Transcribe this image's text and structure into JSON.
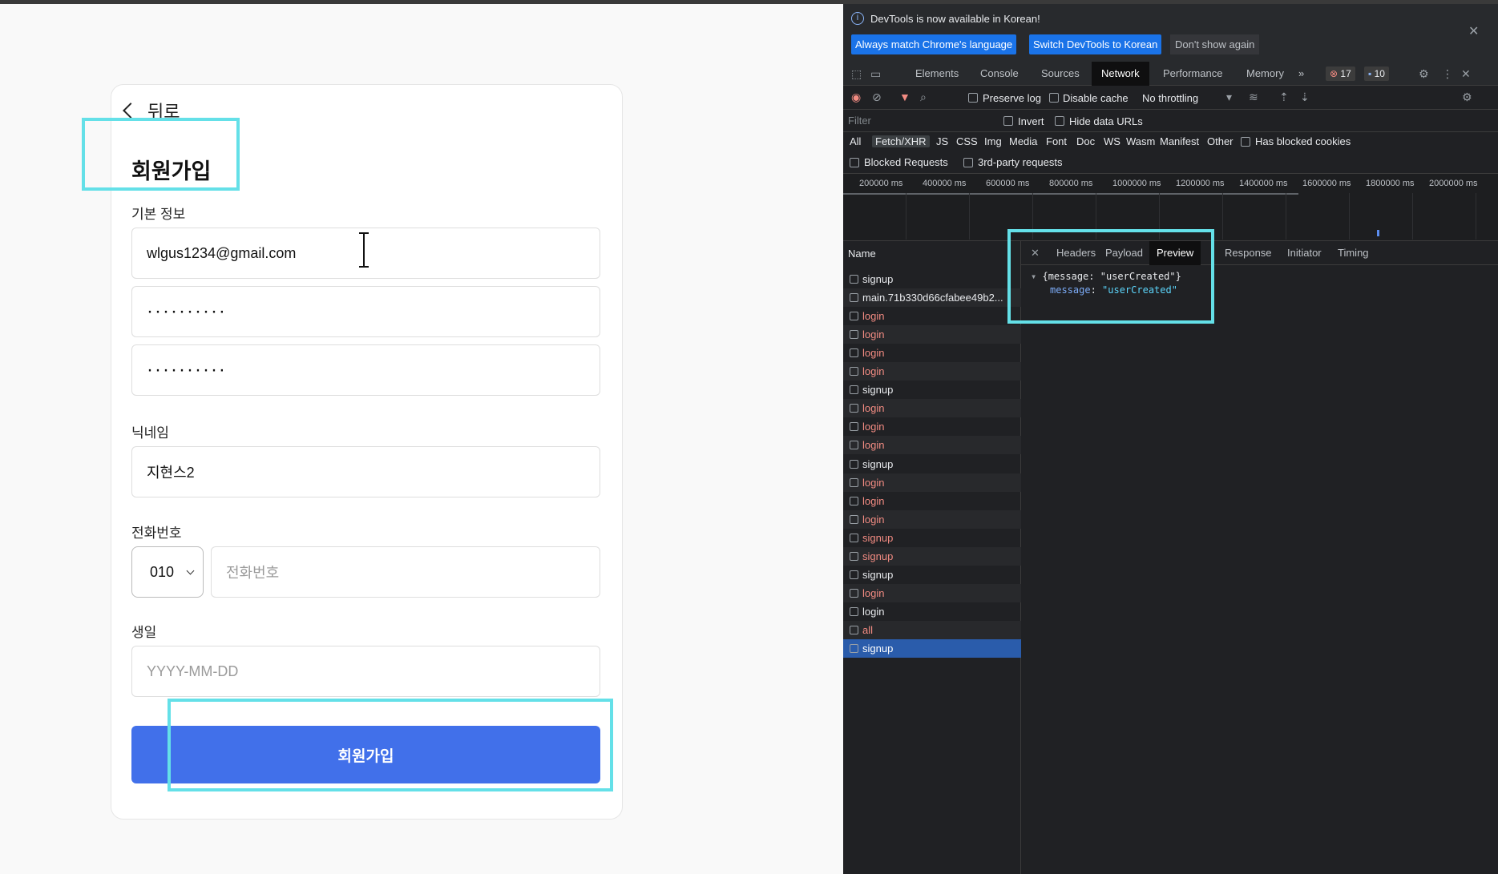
{
  "app": {
    "back_label": "뒤로",
    "title": "회원가입",
    "basic_info_label": "기본 정보",
    "email_value": "wlgus1234@gmail.com",
    "password_value": "··········",
    "password_confirm_value": "··········",
    "nickname_label": "닉네임",
    "nickname_value": "지현스2",
    "phone_label": "전화번호",
    "phone_prefix": "010",
    "phone_placeholder": "전화번호",
    "birthday_label": "생일",
    "birthday_placeholder": "YYYY-MM-DD",
    "submit_label": "회원가입",
    "accent_color": "#4170ea",
    "highlight_color": "#64e0e8"
  },
  "devtools": {
    "info_message": "DevTools is now available in Korean!",
    "btn_match_language": "Always match Chrome's language",
    "btn_switch_korean": "Switch DevTools to Korean",
    "btn_dont_show": "Don't show again",
    "tabs": [
      "Elements",
      "Console",
      "Sources",
      "Network",
      "Performance",
      "Memory"
    ],
    "active_tab": "Network",
    "more_tabs": "»",
    "error_count": "17",
    "message_count": "10",
    "preserve_log": "Preserve log",
    "disable_cache": "Disable cache",
    "throttling": "No throttling",
    "filter_placeholder": "Filter",
    "invert": "Invert",
    "hide_data_urls": "Hide data URLs",
    "types": [
      "All",
      "Fetch/XHR",
      "JS",
      "CSS",
      "Img",
      "Media",
      "Font",
      "Doc",
      "WS",
      "Wasm",
      "Manifest",
      "Other"
    ],
    "active_type": "Fetch/XHR",
    "has_blocked_cookies": "Has blocked cookies",
    "blocked_requests": "Blocked Requests",
    "third_party": "3rd-party requests",
    "timeline_labels": [
      "200000 ms",
      "400000 ms",
      "600000 ms",
      "800000 ms",
      "1000000 ms",
      "1200000 ms",
      "1400000 ms",
      "1600000 ms",
      "1800000 ms",
      "2000000 ms"
    ],
    "name_header": "Name",
    "requests": [
      {
        "name": "signup",
        "status": "ok"
      },
      {
        "name": "main.71b330d66cfabee49b2...",
        "status": "ok"
      },
      {
        "name": "login",
        "status": "error"
      },
      {
        "name": "login",
        "status": "error"
      },
      {
        "name": "login",
        "status": "error"
      },
      {
        "name": "login",
        "status": "error"
      },
      {
        "name": "signup",
        "status": "ok"
      },
      {
        "name": "login",
        "status": "error"
      },
      {
        "name": "login",
        "status": "error"
      },
      {
        "name": "login",
        "status": "error"
      },
      {
        "name": "signup",
        "status": "ok"
      },
      {
        "name": "login",
        "status": "error"
      },
      {
        "name": "login",
        "status": "error"
      },
      {
        "name": "login",
        "status": "error"
      },
      {
        "name": "signup",
        "status": "error"
      },
      {
        "name": "signup",
        "status": "error"
      },
      {
        "name": "signup",
        "status": "ok"
      },
      {
        "name": "login",
        "status": "error"
      },
      {
        "name": "login",
        "status": "ok"
      },
      {
        "name": "all",
        "status": "error"
      },
      {
        "name": "signup",
        "status": "selected"
      }
    ],
    "detail_tabs": [
      "Headers",
      "Payload",
      "Preview",
      "Response",
      "Initiator",
      "Timing"
    ],
    "active_detail_tab": "Preview",
    "preview_summary": "{message: \"userCreated\"}",
    "preview_key": "message",
    "preview_value": "\"userCreated\""
  }
}
